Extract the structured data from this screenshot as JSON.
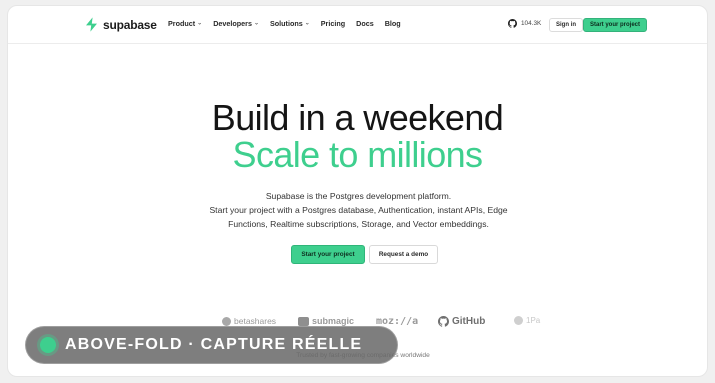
{
  "nav": {
    "logo_text": "supabase",
    "items": [
      {
        "label": "Product",
        "has_dropdown": true
      },
      {
        "label": "Developers",
        "has_dropdown": true
      },
      {
        "label": "Solutions",
        "has_dropdown": true
      },
      {
        "label": "Pricing",
        "has_dropdown": false
      },
      {
        "label": "Docs",
        "has_dropdown": false
      },
      {
        "label": "Blog",
        "has_dropdown": false
      }
    ],
    "github_stars": "104.3K",
    "signin_label": "Sign in",
    "cta_label": "Start your project"
  },
  "hero": {
    "line1": "Build in a weekend",
    "line2": "Scale to millions",
    "subtitle_lines": [
      "Supabase is the Postgres development platform.",
      "Start your project with a Postgres database, Authentication, instant APIs, Edge",
      "Functions, Realtime subscriptions, Storage, and Vector embeddings."
    ],
    "primary_button": "Start your project",
    "secondary_button": "Request a demo"
  },
  "logos": {
    "items": [
      "betashares",
      "submagic",
      "moz://a",
      "GitHub",
      "1Pa"
    ],
    "caption": "Trusted by fast-growing companies worldwide"
  },
  "overlay_badge": {
    "label": "ABOVE-FOLD · CAPTURE RÉELLE"
  },
  "colors": {
    "brand_green": "#3ecf8e",
    "text_dark": "#151515",
    "badge_bg": "#696969"
  },
  "icons": {
    "logo": "supabase-bolt-icon",
    "github": "github-icon",
    "caret": "chevron-down-icon"
  }
}
